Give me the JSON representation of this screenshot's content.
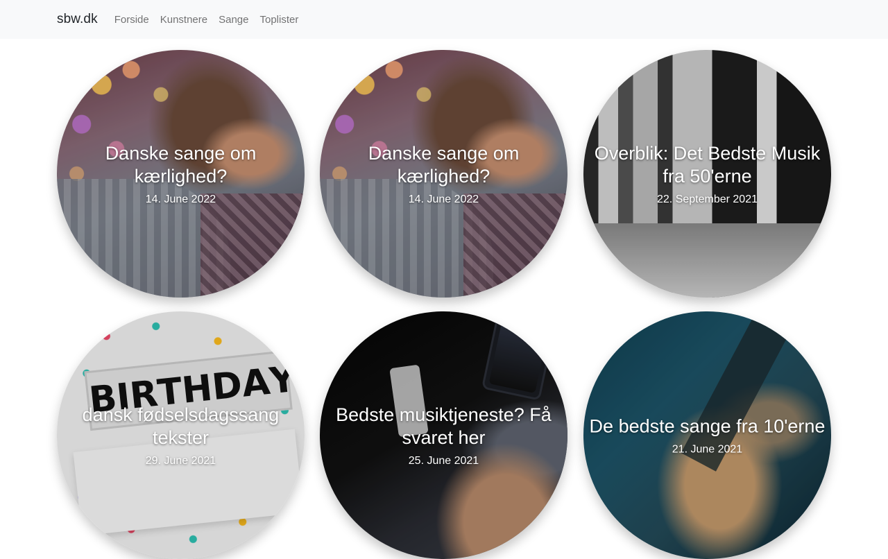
{
  "navbar": {
    "brand": "sbw.dk",
    "links": [
      "Forside",
      "Kunstnere",
      "Sange",
      "Toplister"
    ]
  },
  "posts": [
    {
      "title": "Danske sange om kærlighed?",
      "date": "14. June 2022",
      "image": "couple-bokeh"
    },
    {
      "title": "Danske sange om kærlighed?",
      "date": "14. June 2022",
      "image": "couple-bokeh"
    },
    {
      "title": "Overblik: Det Bedste Musik fra 50'erne",
      "date": "22. September 2021",
      "image": "black-white-handshake"
    },
    {
      "title": "dansk fødselsdagssang tekster",
      "date": "29. June 2021",
      "image": "birthday-confetti"
    },
    {
      "title": "Bedste musiktjeneste? Få svaret her",
      "date": "25. June 2021",
      "image": "headphones-phone"
    },
    {
      "title": "De bedste sange fra 10'erne",
      "date": "21. June 2021",
      "image": "guitar-player"
    }
  ]
}
